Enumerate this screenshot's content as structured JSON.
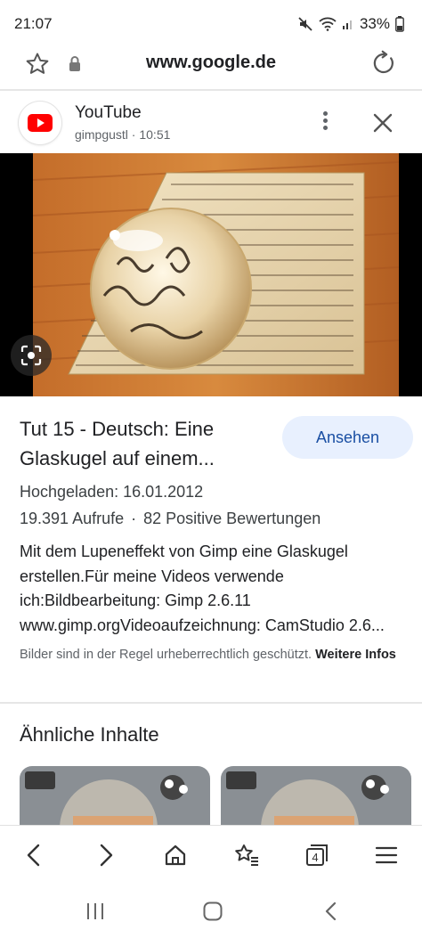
{
  "status_bar": {
    "time": "21:07",
    "battery": "33%"
  },
  "address_bar": {
    "url": "www.google.de"
  },
  "source": {
    "name": "YouTube",
    "meta": "gimpgustl · 10:51"
  },
  "result": {
    "title_line1": "Tut 15 - Deutsch: Eine",
    "title_line2": "Glaskugel auf einem...",
    "watch_label": "Ansehen",
    "uploaded": "Hochgeladen: 16.01.2012",
    "views": "19.391 Aufrufe",
    "separator": "·",
    "likes": "82 Positive Bewertungen",
    "desc_lines": [
      "Mit dem Lupeneffekt von Gimp eine Glaskugel",
      "erstellen.Für meine Videos verwende",
      "ich:Bildbearbeitung: Gimp 2.6.11",
      "www.gimp.orgVideoaufzeichnung: CamStudio 2.6..."
    ],
    "copyright_text": "Bilder sind in der Regel urheberrechtlich geschützt.",
    "copyright_link": "Weitere Infos"
  },
  "related": {
    "heading": "Ähnliche Inhalte"
  },
  "toolbar": {
    "tabs_count": "4"
  },
  "colors": {
    "accent_button_bg": "#e8f0fe",
    "accent_button_text": "#1a4fa3",
    "youtube_red": "#ff0000"
  },
  "icons": [
    "star-icon",
    "lock-icon",
    "reload-icon",
    "youtube-logo-icon",
    "more-vert-icon",
    "close-icon",
    "google-lens-icon",
    "back-icon",
    "forward-icon",
    "home-icon",
    "bookmarks-icon",
    "tabs-icon",
    "menu-icon"
  ]
}
